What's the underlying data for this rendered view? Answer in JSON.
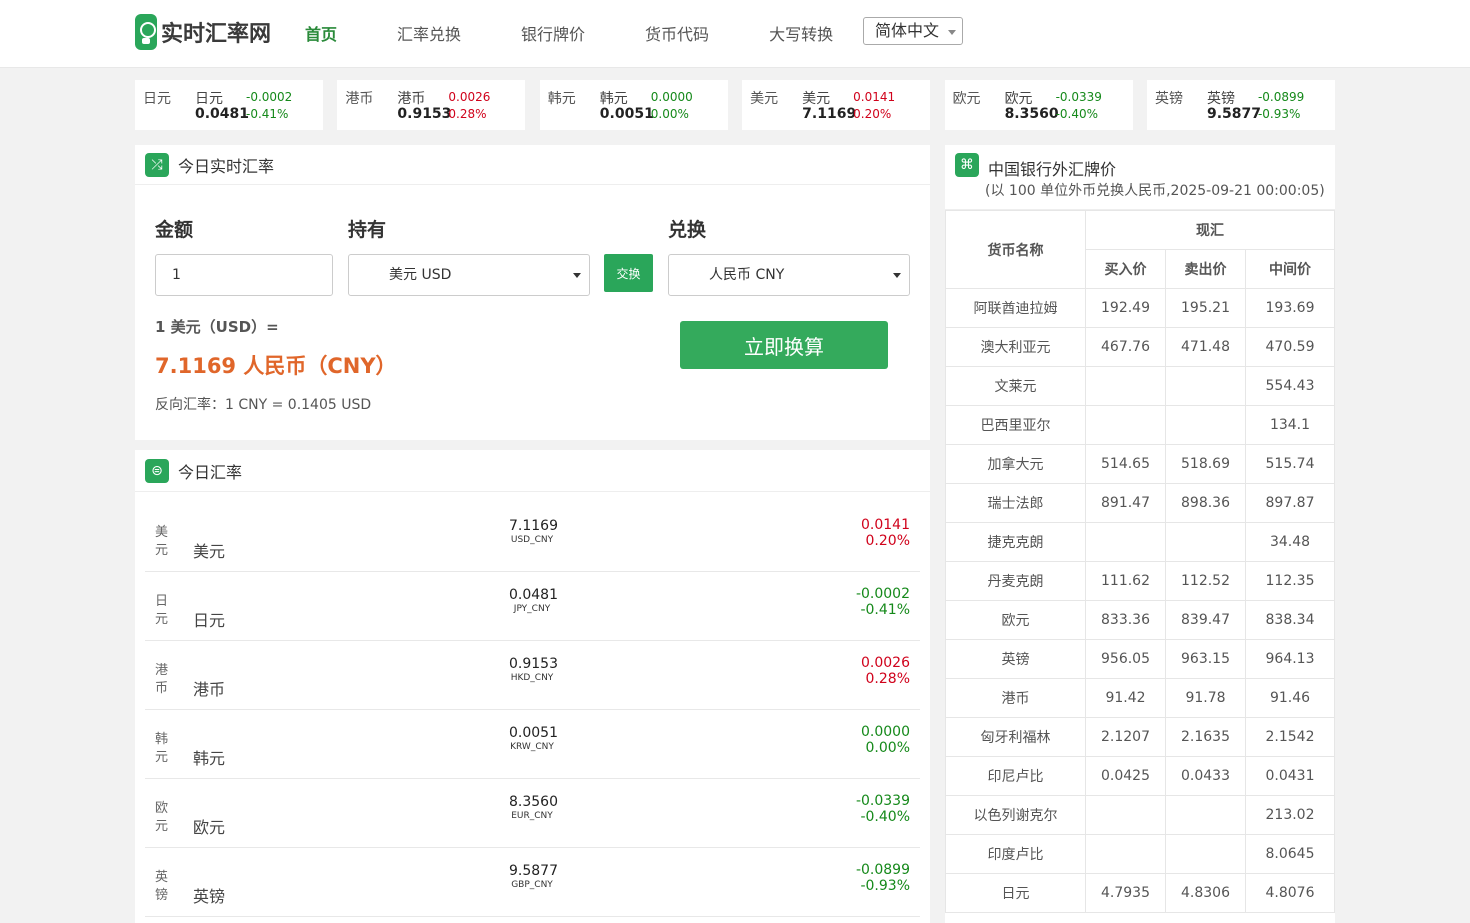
{
  "header": {
    "logo_text": "实时汇率网",
    "nav": [
      "首页",
      "汇率兑换",
      "银行牌价",
      "货币代码",
      "大写转换"
    ],
    "language": "简体中文"
  },
  "ticker": [
    {
      "flag": "日元",
      "name": "日元",
      "value": "0.0481",
      "change": "-0.0002",
      "percent": "-0.41%",
      "dir": "down"
    },
    {
      "flag": "港币",
      "name": "港币",
      "value": "0.9153",
      "change": "0.0026",
      "percent": "0.28%",
      "dir": "up"
    },
    {
      "flag": "韩元",
      "name": "韩元",
      "value": "0.0051",
      "change": "0.0000",
      "percent": "0.00%",
      "dir": "flat"
    },
    {
      "flag": "美元",
      "name": "美元",
      "value": "7.1169",
      "change": "0.0141",
      "percent": "0.20%",
      "dir": "up"
    },
    {
      "flag": "欧元",
      "name": "欧元",
      "value": "8.3560",
      "change": "-0.0339",
      "percent": "-0.40%",
      "dir": "down"
    },
    {
      "flag": "英镑",
      "name": "英镑",
      "value": "9.5877",
      "change": "-0.0899",
      "percent": "-0.93%",
      "dir": "down"
    }
  ],
  "converter": {
    "title": "今日实时汇率",
    "amount_label": "金额",
    "hold_label": "持有",
    "exchange_label": "兑换",
    "amount_value": "1",
    "hold_value": "美元 USD",
    "exchange_value": "人民币 CNY",
    "swap_label": "交换",
    "go_label": "立即换算",
    "result_line1": "1 美元（USD）=",
    "result_line2": "7.1169 人民币（CNY）",
    "reverse_line": "反向汇率：1 CNY = 0.1405 USD"
  },
  "today": {
    "title": "今日汇率",
    "rows": [
      {
        "flag": "美元",
        "name": "美元",
        "value": "7.1169",
        "code": "USD_CNY",
        "change": "0.0141",
        "percent": "0.20%",
        "dir": "up"
      },
      {
        "flag": "日元",
        "name": "日元",
        "value": "0.0481",
        "code": "JPY_CNY",
        "change": "-0.0002",
        "percent": "-0.41%",
        "dir": "down"
      },
      {
        "flag": "港币",
        "name": "港币",
        "value": "0.9153",
        "code": "HKD_CNY",
        "change": "0.0026",
        "percent": "0.28%",
        "dir": "up"
      },
      {
        "flag": "韩元",
        "name": "韩元",
        "value": "0.0051",
        "code": "KRW_CNY",
        "change": "0.0000",
        "percent": "0.00%",
        "dir": "flat"
      },
      {
        "flag": "欧元",
        "name": "欧元",
        "value": "8.3560",
        "code": "EUR_CNY",
        "change": "-0.0339",
        "percent": "-0.40%",
        "dir": "down"
      },
      {
        "flag": "英镑",
        "name": "英镑",
        "value": "9.5877",
        "code": "GBP_CNY",
        "change": "-0.0899",
        "percent": "-0.93%",
        "dir": "down"
      }
    ]
  },
  "bank": {
    "title": "中国银行外汇牌价",
    "subtitle": "(以 100 单位外币兑换人民币,2025-09-21 00:00:05)",
    "col_name": "货币名称",
    "col_group": "现汇",
    "col_buy": "买入价",
    "col_sell": "卖出价",
    "col_mid": "中间价",
    "rows": [
      {
        "name": "阿联酋迪拉姆",
        "buy": "192.49",
        "sell": "195.21",
        "mid": "193.69"
      },
      {
        "name": "澳大利亚元",
        "buy": "467.76",
        "sell": "471.48",
        "mid": "470.59"
      },
      {
        "name": "文莱元",
        "buy": "",
        "sell": "",
        "mid": "554.43"
      },
      {
        "name": "巴西里亚尔",
        "buy": "",
        "sell": "",
        "mid": "134.1"
      },
      {
        "name": "加拿大元",
        "buy": "514.65",
        "sell": "518.69",
        "mid": "515.74"
      },
      {
        "name": "瑞士法郎",
        "buy": "891.47",
        "sell": "898.36",
        "mid": "897.87"
      },
      {
        "name": "捷克克朗",
        "buy": "",
        "sell": "",
        "mid": "34.48"
      },
      {
        "name": "丹麦克朗",
        "buy": "111.62",
        "sell": "112.52",
        "mid": "112.35"
      },
      {
        "name": "欧元",
        "buy": "833.36",
        "sell": "839.47",
        "mid": "838.34"
      },
      {
        "name": "英镑",
        "buy": "956.05",
        "sell": "963.15",
        "mid": "964.13"
      },
      {
        "name": "港币",
        "buy": "91.42",
        "sell": "91.78",
        "mid": "91.46"
      },
      {
        "name": "匈牙利福林",
        "buy": "2.1207",
        "sell": "2.1635",
        "mid": "2.1542"
      },
      {
        "name": "印尼卢比",
        "buy": "0.0425",
        "sell": "0.0433",
        "mid": "0.0431"
      },
      {
        "name": "以色列谢克尔",
        "buy": "",
        "sell": "",
        "mid": "213.02"
      },
      {
        "name": "印度卢比",
        "buy": "",
        "sell": "",
        "mid": "8.0645"
      },
      {
        "name": "日元",
        "buy": "4.7935",
        "sell": "4.8306",
        "mid": "4.8076"
      }
    ]
  }
}
